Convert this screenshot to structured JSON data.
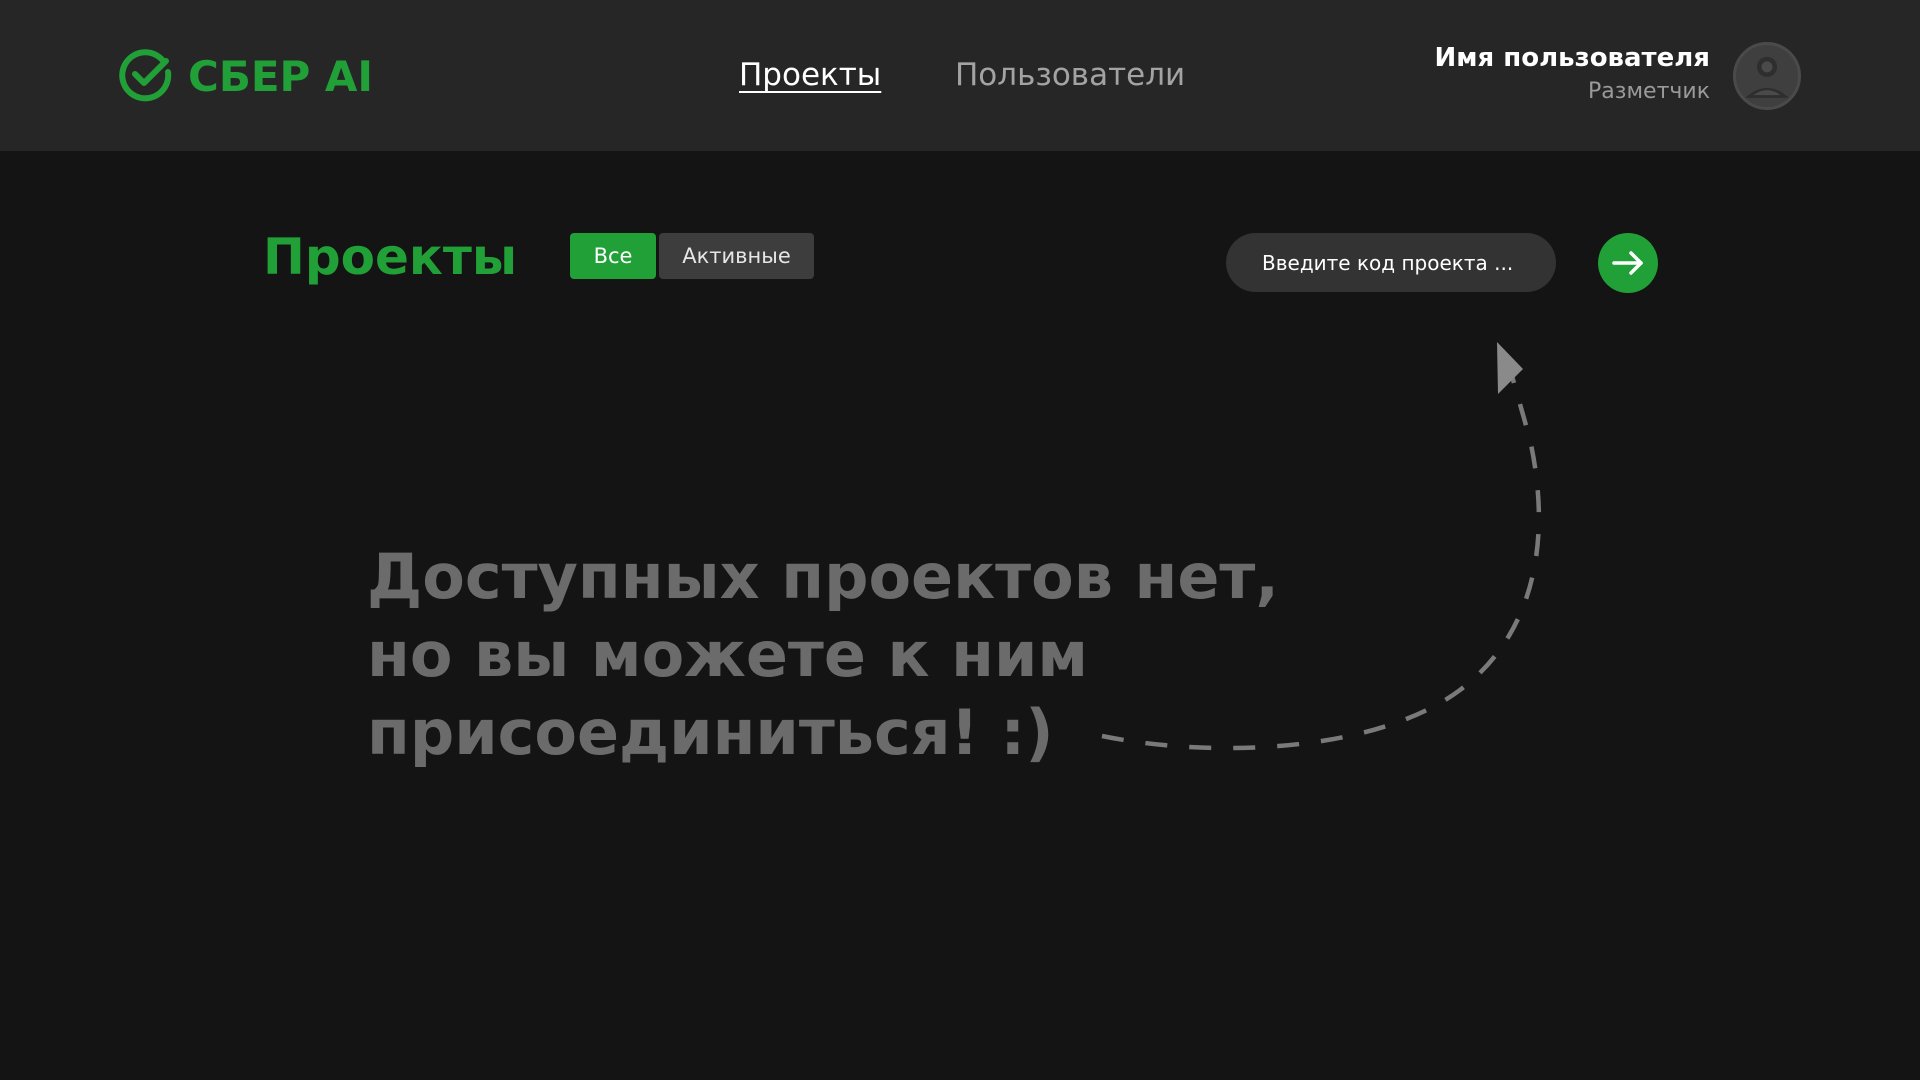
{
  "header": {
    "logo": {
      "text": "СБЕР AI",
      "icon": "sber-check-logo-icon",
      "color": "#21a038"
    },
    "nav": [
      {
        "label": "Проекты",
        "active": true
      },
      {
        "label": "Пользователи",
        "active": false
      }
    ],
    "user": {
      "name": "Имя пользователя",
      "role": "Разметчик",
      "avatar_icon": "user-avatar-icon"
    }
  },
  "main": {
    "title": "Проекты",
    "filters": [
      {
        "label": "Все",
        "selected": true
      },
      {
        "label": "Активные",
        "selected": false
      }
    ],
    "project_code_input": {
      "value": "",
      "placeholder": "Введите код проекта ..."
    },
    "submit_icon": "arrow-right-icon",
    "empty_state": {
      "lines": [
        "Доступных проектов нет,",
        "но вы можете к ним",
        "присоединиться! :)"
      ],
      "hint_icon": "dashed-curved-arrow-icon"
    }
  },
  "colors": {
    "accent": "#21a038",
    "header_bg": "#262626",
    "page_bg": "#141414",
    "muted_text": "#6b6b6b"
  }
}
